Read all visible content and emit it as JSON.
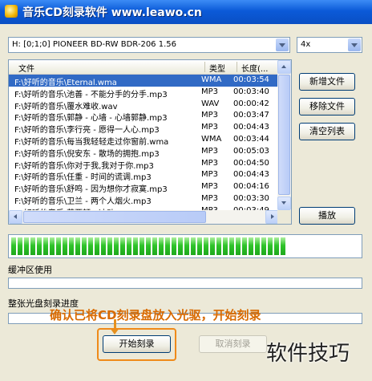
{
  "window": {
    "title": "音乐CD刻录软件 www.leawo.cn"
  },
  "drive": {
    "selected": "H:  [0;1;0] PIONEER  BD-RW   BDR-206  1.56"
  },
  "speed": {
    "selected": "4x"
  },
  "file_list": {
    "columns": [
      "文件",
      "类型",
      "长度(..."
    ],
    "rows": [
      {
        "name": "F:\\好听的音乐\\Eternal.wma",
        "type": "WMA",
        "duration": "00:03:54",
        "selected": true
      },
      {
        "name": "F:\\好听的音乐\\池善 - 不能分手的分手.mp3",
        "type": "MP3",
        "duration": "00:03:40"
      },
      {
        "name": "F:\\好听的音乐\\覆水难收.wav",
        "type": "WAV",
        "duration": "00:00:42"
      },
      {
        "name": "F:\\好听的音乐\\郭静 - 心墙 - 心墙郭静.mp3",
        "type": "MP3",
        "duration": "00:03:47"
      },
      {
        "name": "F:\\好听的音乐\\李行亮 - 愿得一人心.mp3",
        "type": "MP3",
        "duration": "00:04:43"
      },
      {
        "name": "F:\\好听的音乐\\每当我轻轻走过你窗前.wma",
        "type": "WMA",
        "duration": "00:03:44"
      },
      {
        "name": "F:\\好听的音乐\\倪安东 - 散场的拥抱.mp3",
        "type": "MP3",
        "duration": "00:05:03"
      },
      {
        "name": "F:\\好听的音乐\\你对于我,我对于你.mp3",
        "type": "MP3",
        "duration": "00:04:50"
      },
      {
        "name": "F:\\好听的音乐\\任重 - 时间的谎调.mp3",
        "type": "MP3",
        "duration": "00:04:43"
      },
      {
        "name": "F:\\好听的音乐\\舒鸣 - 因为想你才寂寞.mp3",
        "type": "MP3",
        "duration": "00:04:16"
      },
      {
        "name": "F:\\好听的音乐\\卫兰 - 两个人烟火.mp3",
        "type": "MP3",
        "duration": "00:03:30"
      },
      {
        "name": "F:\\好听的音乐\\萧亚轩 - 冲动.mp3",
        "type": "MP3",
        "duration": "00:03:49"
      },
      {
        "name": "F:\\好听的音乐\\谢容儿 - 寂寞.mp3",
        "type": "MP3",
        "duration": "00:04:12"
      }
    ]
  },
  "buttons": {
    "add_file": "新增文件",
    "remove_file": "移除文件",
    "clear_list": "清空列表",
    "play": "播放",
    "start_burn": "开始刻录",
    "cancel_burn": "取消刻录"
  },
  "progress": {
    "fraction": 0.79,
    "color": "#2fc42a"
  },
  "buffer": {
    "label": "缓冲区使用",
    "fraction": 0
  },
  "disc": {
    "label": "整张光盘刻录进度",
    "fraction": 0
  },
  "annotation": {
    "text": "确认已将CD刻录盘放入光驱，开始刻录",
    "color": "#d86a00"
  },
  "watermark": {
    "text": "软件技巧"
  }
}
